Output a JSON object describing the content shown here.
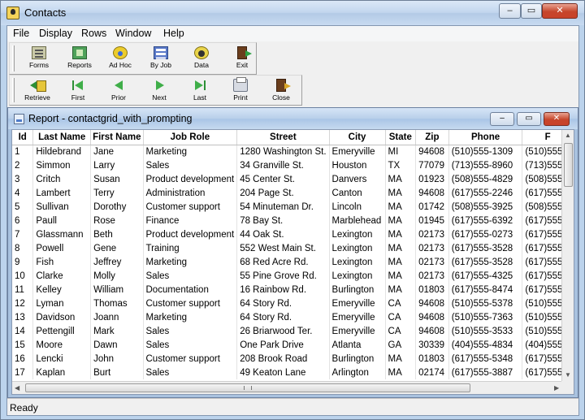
{
  "window": {
    "title": "Contacts",
    "min_icon": "minimize-icon",
    "max_icon": "maximize-icon",
    "close_icon": "close-icon",
    "min_glyph": "–",
    "max_glyph": "▭",
    "close_glyph": "✕"
  },
  "menu": [
    "File",
    "Display",
    "Rows",
    "Window",
    "Help"
  ],
  "toolbar1": [
    {
      "label": "Forms",
      "icon": "forms-icon"
    },
    {
      "label": "Reports",
      "icon": "reports-icon"
    },
    {
      "label": "Ad Hoc",
      "icon": "adhoc-icon"
    },
    {
      "label": "By Job",
      "icon": "byjob-icon"
    },
    {
      "label": "Data",
      "icon": "data-icon"
    },
    {
      "label": "Exit",
      "icon": "exit-icon"
    }
  ],
  "toolbar2": [
    {
      "label": "Retrieve",
      "icon": "retrieve-icon"
    },
    {
      "label": "First",
      "icon": "first-icon"
    },
    {
      "label": "Prior",
      "icon": "prior-icon"
    },
    {
      "label": "Next",
      "icon": "next-icon"
    },
    {
      "label": "Last",
      "icon": "last-icon"
    },
    {
      "label": "Print",
      "icon": "print-icon"
    },
    {
      "label": "Close",
      "icon": "close-icon"
    }
  ],
  "report": {
    "title": "Report - contactgrid_with_prompting",
    "columns": [
      "Id",
      "Last Name",
      "First Name",
      "Job Role",
      "Street",
      "City",
      "State",
      "Zip",
      "Phone",
      "F"
    ],
    "rows": [
      [
        "1",
        "Hildebrand",
        "Jane",
        "Marketing",
        "1280 Washington St.",
        "Emeryville",
        "MI",
        "94608",
        "(510)555-1309",
        "(510)555"
      ],
      [
        "2",
        "Simmon",
        "Larry",
        "Sales",
        "34 Granville St.",
        "Houston",
        "TX",
        "77079",
        "(713)555-8960",
        "(713)555"
      ],
      [
        "3",
        "Critch",
        "Susan",
        "Product development",
        "45 Center St.",
        "Danvers",
        "MA",
        "01923",
        "(508)555-4829",
        "(508)555"
      ],
      [
        "4",
        "Lambert",
        "Terry",
        "Administration",
        "204 Page St.",
        "Canton",
        "MA",
        "94608",
        "(617)555-2246",
        "(617)555"
      ],
      [
        "5",
        "Sullivan",
        "Dorothy",
        "Customer support",
        "54 Minuteman Dr.",
        "Lincoln",
        "MA",
        "01742",
        "(508)555-3925",
        "(508)555"
      ],
      [
        "6",
        "Paull",
        "Rose",
        "Finance",
        "78 Bay St.",
        "Marblehead",
        "MA",
        "01945",
        "(617)555-6392",
        "(617)555"
      ],
      [
        "7",
        "Glassmann",
        "Beth",
        "Product development",
        "44 Oak St.",
        "Lexington",
        "MA",
        "02173",
        "(617)555-0273",
        "(617)555"
      ],
      [
        "8",
        "Powell",
        "Gene",
        "Training",
        "552 West Main St.",
        "Lexington",
        "MA",
        "02173",
        "(617)555-3528",
        "(617)555"
      ],
      [
        "9",
        "Fish",
        "Jeffrey",
        "Marketing",
        "68 Red Acre Rd.",
        "Lexington",
        "MA",
        "02173",
        "(617)555-3528",
        "(617)555"
      ],
      [
        "10",
        "Clarke",
        "Molly",
        "Sales",
        "55 Pine Grove Rd.",
        "Lexington",
        "MA",
        "02173",
        "(617)555-4325",
        "(617)555"
      ],
      [
        "11",
        "Kelley",
        "William",
        "Documentation",
        "16 Rainbow Rd.",
        "Burlington",
        "MA",
        "01803",
        "(617)555-8474",
        "(617)555"
      ],
      [
        "12",
        "Lyman",
        "Thomas",
        "Customer support",
        "64 Story Rd.",
        "Emeryville",
        "CA",
        "94608",
        "(510)555-5378",
        "(510)555"
      ],
      [
        "13",
        "Davidson",
        "Joann",
        "Marketing",
        "64 Story Rd.",
        "Emeryville",
        "CA",
        "94608",
        "(510)555-7363",
        "(510)555"
      ],
      [
        "14",
        "Pettengill",
        "Mark",
        "Sales",
        "26 Briarwood Ter.",
        "Emeryville",
        "CA",
        "94608",
        "(510)555-3533",
        "(510)555"
      ],
      [
        "15",
        "Moore",
        "Dawn",
        "Sales",
        "One Park Drive",
        "Atlanta",
        "GA",
        "30339",
        "(404)555-4834",
        "(404)555"
      ],
      [
        "16",
        "Lencki",
        "John",
        "Customer support",
        "208 Brook Road",
        "Burlington",
        "MA",
        "01803",
        "(617)555-5348",
        "(617)555"
      ],
      [
        "17",
        "Kaplan",
        "Burt",
        "Sales",
        "49 Keaton Lane",
        "Arlington",
        "MA",
        "02174",
        "(617)555-3887",
        "(617)555"
      ]
    ]
  },
  "scroll": {
    "up_glyph": "▲",
    "down_glyph": "▼",
    "left_glyph": "◀",
    "right_glyph": "▶"
  },
  "status": {
    "text": "Ready"
  }
}
